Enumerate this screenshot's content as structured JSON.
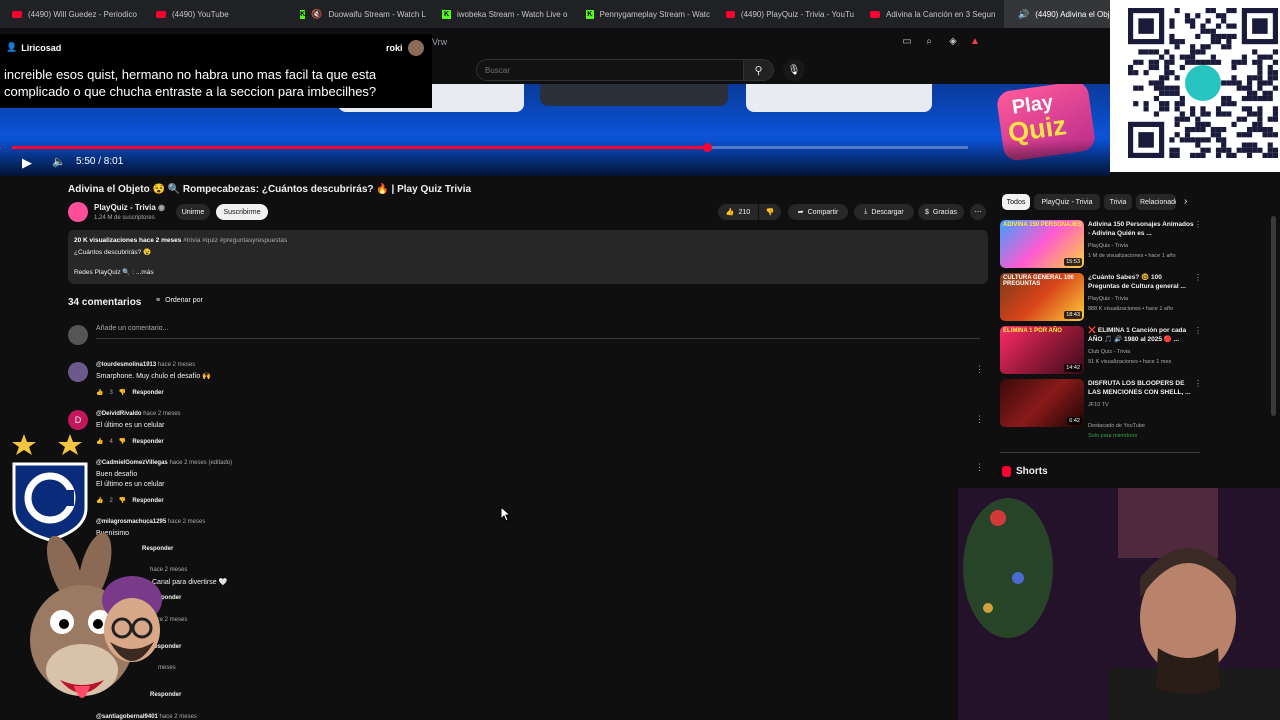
{
  "browser": {
    "tabs": [
      {
        "label": "(4490) Will Guedez - Periodico",
        "icon": "youtube-icon"
      },
      {
        "label": "(4490) YouTube",
        "icon": "youtube-icon"
      },
      {
        "label": "Duowaifu Stream - Watch L",
        "icon": "kick-icon"
      },
      {
        "label": "iwobeka Stream - Watch Live o",
        "icon": "kick-icon"
      },
      {
        "label": "Pennygameplay Stream - Watc",
        "icon": "kick-icon"
      },
      {
        "label": "(4490) PlayQuiz - Trivia - YouTu",
        "icon": "youtube-icon"
      },
      {
        "label": "Adivina la Canción en 3 Segun",
        "icon": "youtube-icon"
      },
      {
        "label": "(4490) Adivina el Obje",
        "icon": "youtube-icon"
      }
    ],
    "address_fragment": "Vrw"
  },
  "header": {
    "search_placeholder": "Buscar",
    "search_icon": "search-icon",
    "mic_icon": "mic-icon"
  },
  "chat": {
    "user": "Liricosad",
    "right_name": "roki",
    "message": "increible esos quist, hermano no habra uno mas facil ta que esta complicado o que chucha entraste a la seccion para imbecilhes?"
  },
  "player": {
    "time": "5:50 / 8:01",
    "progress": 0.727,
    "logo_top": "Play",
    "logo_bottom": "Quiz"
  },
  "video": {
    "title": "Adivina el Objeto 😵 🔍 Rompecabezas: ¿Cuántos descubrirás? 🔥 | Play Quiz Trivia",
    "channel": "PlayQuiz - Trivia",
    "subs": "1,24 M de suscriptores",
    "join": "Unirme",
    "subscribe": "Suscribirme",
    "likes": "210",
    "share": "Compartir",
    "download": "Descargar",
    "thanks": "Gracias"
  },
  "description": {
    "stats": "20 K visualizaciones  hace 2 meses",
    "tags": "#trivia #quiz #preguntasyrespuestas",
    "line2": "¿Cuántos descubrirás? 😵",
    "line3": "Redes PlayQuiz 🔍 : ...más"
  },
  "comments": {
    "count": "34 comentarios",
    "sort": "Ordenar por",
    "add_placeholder": "Añade un comentario...",
    "reply": "Responder",
    "items": [
      {
        "author": "@lourdesmolina1913",
        "when": "hace 2 meses",
        "text": "Smarphone. Muy chulo el desafío 🙌",
        "likes": "3"
      },
      {
        "author": "@DeividRivaldo",
        "when": "hace 2 meses",
        "text": "El último es un celular",
        "likes": "4",
        "initial": "D"
      },
      {
        "author": "@CadmielGomezVillegas",
        "when": "hace 2 meses (editado)",
        "text": "Buen desafío",
        "text2": "El último es un celular",
        "likes": "2"
      },
      {
        "author": "@milagrosmachuca1295",
        "when": "hace 2 meses",
        "text": "Buenísimo"
      },
      {
        "author": "",
        "when": "hace 2 meses",
        "text": "Canal para divertirse 🤍"
      },
      {
        "author": "",
        "when": "hace 2 meses",
        "text": "r"
      },
      {
        "author": "",
        "when": "meses",
        "text": ""
      },
      {
        "author": "@santiagobernal9401",
        "when": "hace 2 meses",
        "text": ""
      }
    ]
  },
  "sidebar": {
    "chips": [
      "Todos",
      "PlayQuiz - Trivia",
      "Trivia",
      "Relacionados"
    ],
    "recs": [
      {
        "title": "Adivina 150 Personajes Animados - Adivina Quién es ...",
        "channel": "PlayQuiz - Trivia",
        "meta": "1 M de visualizaciones • hace 1 año",
        "duration": "15:53",
        "thumb_text": "ADIVINA 150 PERSONAJES"
      },
      {
        "title": "¿Cuánto Sabes? 🤓 100 Preguntas de Cultura general ...",
        "channel": "PlayQuiz - Trivia",
        "meta": "888 K visualizaciones • hace 1 año",
        "duration": "18:43",
        "thumb_text": "CULTURA GENERAL 100 PREGUNTAS"
      },
      {
        "title": "❌ ELIMINA 1 Canción por cada AÑO 🎵 🔊 1980 al 2025 🔴 ...",
        "channel": "Club Quiz - Trivia",
        "meta": "91 K visualizaciones • hace 1 mes",
        "duration": "14:42",
        "thumb_text": "ELIMINA 1 POR AÑO"
      },
      {
        "title": "DISFRUTA LOS BLOOPERS DE LAS MENCIONES CON SHELL, ...",
        "channel": "JF10 TV",
        "meta": "Destacado de YouTube",
        "badge": "Solo para miembros",
        "duration": "6:42",
        "thumb_text": ""
      }
    ],
    "shorts": "Shorts"
  },
  "colors": {
    "accent": "#ff0033",
    "bg": "#0f0f0f",
    "surface": "#272727"
  }
}
